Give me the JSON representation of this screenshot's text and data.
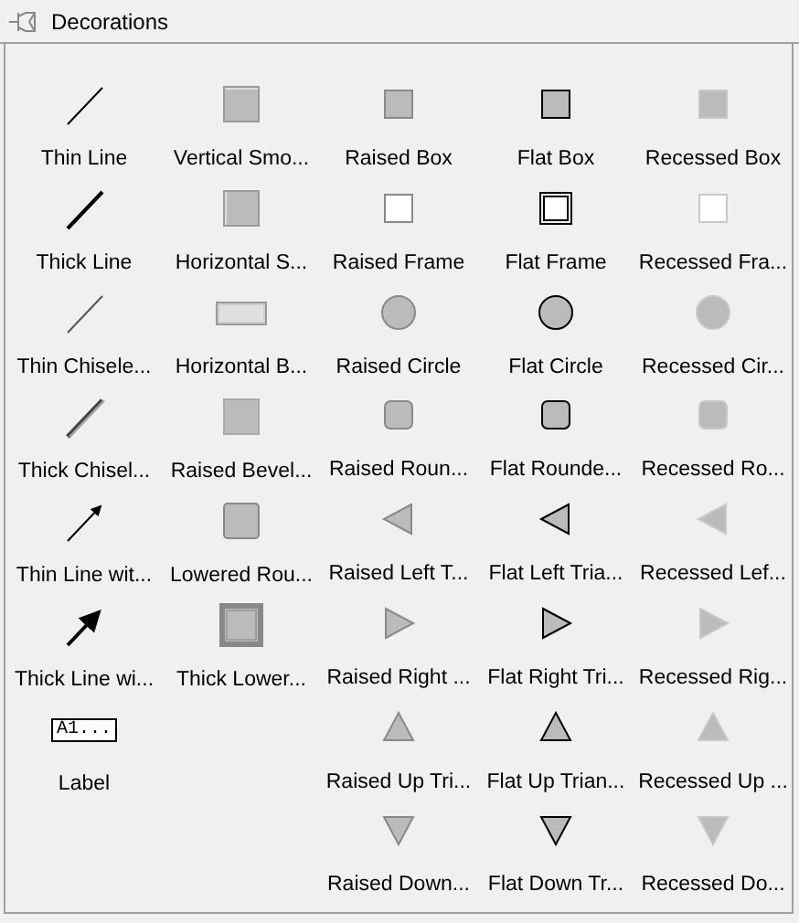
{
  "panel": {
    "title": "Decorations"
  },
  "columns": [
    {
      "items": [
        {
          "kind": "thin-line",
          "label": "Thin Line"
        },
        {
          "kind": "thick-line",
          "label": "Thick Line"
        },
        {
          "kind": "thin-chisel",
          "label": "Thin Chisele..."
        },
        {
          "kind": "thick-chisel",
          "label": "Thick Chisel..."
        },
        {
          "kind": "thin-arrow",
          "label": "Thin Line wit..."
        },
        {
          "kind": "thick-arrow",
          "label": "Thick Line wi..."
        },
        {
          "kind": "label",
          "sample": "A1...",
          "label": "Label"
        }
      ]
    },
    {
      "items": [
        {
          "kind": "vsmooth",
          "label": "Vertical Smo..."
        },
        {
          "kind": "hsmooth",
          "label": "Horizontal S..."
        },
        {
          "kind": "hbar",
          "label": "Horizontal B..."
        },
        {
          "kind": "bevel",
          "label": "Raised Bevel..."
        },
        {
          "kind": "lowered-round",
          "label": "Lowered Rou..."
        },
        {
          "kind": "thick-lowered",
          "label": "Thick Lower..."
        }
      ]
    },
    {
      "items": [
        {
          "kind": "raised-box",
          "label": "Raised Box"
        },
        {
          "kind": "raised-frame",
          "label": "Raised Frame"
        },
        {
          "kind": "raised-circle",
          "label": "Raised Circle"
        },
        {
          "kind": "raised-rounded",
          "label": "Raised Roun..."
        },
        {
          "kind": "raised-left",
          "label": "Raised Left T..."
        },
        {
          "kind": "raised-right",
          "label": "Raised Right ..."
        },
        {
          "kind": "raised-up",
          "label": "Raised Up Tri..."
        },
        {
          "kind": "raised-down",
          "label": "Raised Down..."
        }
      ]
    },
    {
      "items": [
        {
          "kind": "flat-box",
          "label": "Flat Box"
        },
        {
          "kind": "flat-frame",
          "label": "Flat Frame"
        },
        {
          "kind": "flat-circle",
          "label": "Flat Circle"
        },
        {
          "kind": "flat-rounded",
          "label": "Flat Rounde..."
        },
        {
          "kind": "flat-left",
          "label": "Flat Left Tria..."
        },
        {
          "kind": "flat-right",
          "label": "Flat Right Tri..."
        },
        {
          "kind": "flat-up",
          "label": "Flat Up Trian..."
        },
        {
          "kind": "flat-down",
          "label": "Flat Down Tr..."
        }
      ]
    },
    {
      "items": [
        {
          "kind": "recessed-box",
          "label": "Recessed Box"
        },
        {
          "kind": "recessed-frame",
          "label": "Recessed Fra..."
        },
        {
          "kind": "recessed-circle",
          "label": "Recessed Cir..."
        },
        {
          "kind": "recessed-rounded",
          "label": "Recessed Ro..."
        },
        {
          "kind": "recessed-left",
          "label": "Recessed Lef..."
        },
        {
          "kind": "recessed-right",
          "label": "Recessed Rig..."
        },
        {
          "kind": "recessed-up",
          "label": "Recessed Up ..."
        },
        {
          "kind": "recessed-down",
          "label": "Recessed Do..."
        }
      ]
    }
  ]
}
